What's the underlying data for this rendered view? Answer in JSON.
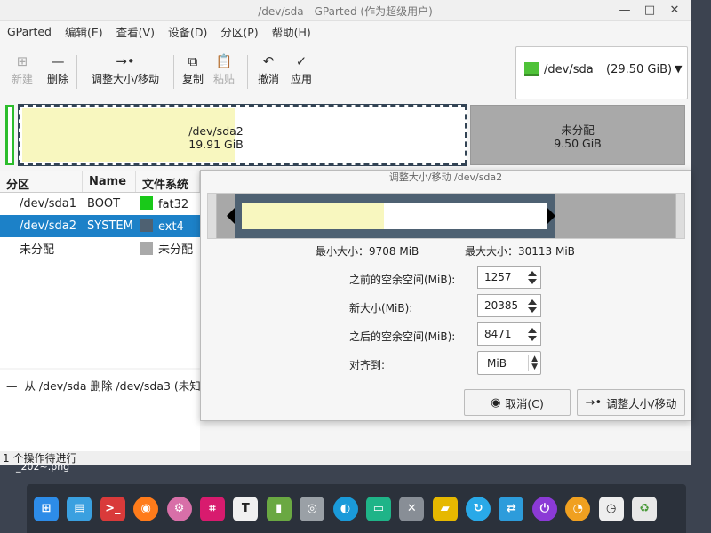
{
  "window": {
    "title": "/dev/sda - GParted (作为超级用户)",
    "controls": {
      "minimize": "—",
      "maximize": "□",
      "close": "✕"
    }
  },
  "menu": [
    "GParted",
    "编辑(E)",
    "查看(V)",
    "设备(D)",
    "分区(P)",
    "帮助(H)"
  ],
  "toolbar": {
    "new": "新建",
    "delete": "删除",
    "resize": "调整大小/移动",
    "copy": "复制",
    "paste": "粘贴",
    "undo": "撤消",
    "apply": "应用"
  },
  "device": {
    "name": "/dev/sda",
    "size": "(29.50 GiB)"
  },
  "disk_graphic": {
    "sda2": {
      "name": "/dev/sda2",
      "size": "19.91 GiB"
    },
    "unallocated": {
      "name": "未分配",
      "size": "9.50 GiB"
    }
  },
  "partition_list": {
    "headers": [
      "分区",
      "Name",
      "文件系统"
    ],
    "rows": [
      {
        "partition": "/dev/sda1",
        "name": "BOOT",
        "fs": "fat32",
        "color": "#19c919"
      },
      {
        "partition": "/dev/sda2",
        "name": "SYSTEM",
        "fs": "ext4",
        "color": "#4e6172"
      },
      {
        "partition": "未分配",
        "name": "",
        "fs": "未分配",
        "color": "#a9a9a9"
      }
    ]
  },
  "operations": {
    "item": "从 /dev/sda 删除 /dev/sda3 (未知"
  },
  "status": "1 个操作待进行",
  "dialog": {
    "title": "调整大小/移动 /dev/sda2",
    "min_size": "最小大小：9708 MiB",
    "max_size": "最大大小：30113 MiB",
    "free_before_label": "之前的空余空间(MiB):",
    "free_before": "1257",
    "new_size_label": "新大小(MiB):",
    "new_size": "20385",
    "free_after_label": "之后的空余空间(MiB):",
    "free_after": "8471",
    "align_label": "对齐到:",
    "align_value": "MiB",
    "cancel": "取消(C)",
    "confirm": "调整大小/移动"
  },
  "desktop": {
    "file_label": "_202~.png"
  },
  "dock": [
    {
      "icon": "launcher-icon",
      "color": "#2d8ce8"
    },
    {
      "icon": "file-manager-icon",
      "color": "#3aa0e0"
    },
    {
      "icon": "terminal-icon",
      "color": "#d93a3a"
    },
    {
      "icon": "firefox-icon",
      "color": "#ff7b1a"
    },
    {
      "icon": "settings-icon",
      "color": "#d86fa8"
    },
    {
      "icon": "screenshot-icon",
      "color": "#d81b6e"
    },
    {
      "icon": "text-editor-icon",
      "color": "#f0f0f0"
    },
    {
      "icon": "archive-icon",
      "color": "#6aa842"
    },
    {
      "icon": "disk-icon",
      "color": "#9aa0a6"
    },
    {
      "icon": "browser-icon",
      "color": "#1a9ad9"
    },
    {
      "icon": "system-monitor-icon",
      "color": "#1fb488"
    },
    {
      "icon": "tools-icon",
      "color": "#888e96"
    },
    {
      "icon": "usb-icon",
      "color": "#e6b800"
    },
    {
      "icon": "refresh-icon",
      "color": "#29a9e8"
    },
    {
      "icon": "remote-icon",
      "color": "#2d9cdb"
    },
    {
      "icon": "power-icon",
      "color": "#8b3ad6"
    },
    {
      "icon": "update-icon",
      "color": "#f0a020"
    },
    {
      "icon": "clock-icon",
      "color": "#eeeeee"
    },
    {
      "icon": "trash-icon",
      "color": "#e8e8e8"
    }
  ]
}
